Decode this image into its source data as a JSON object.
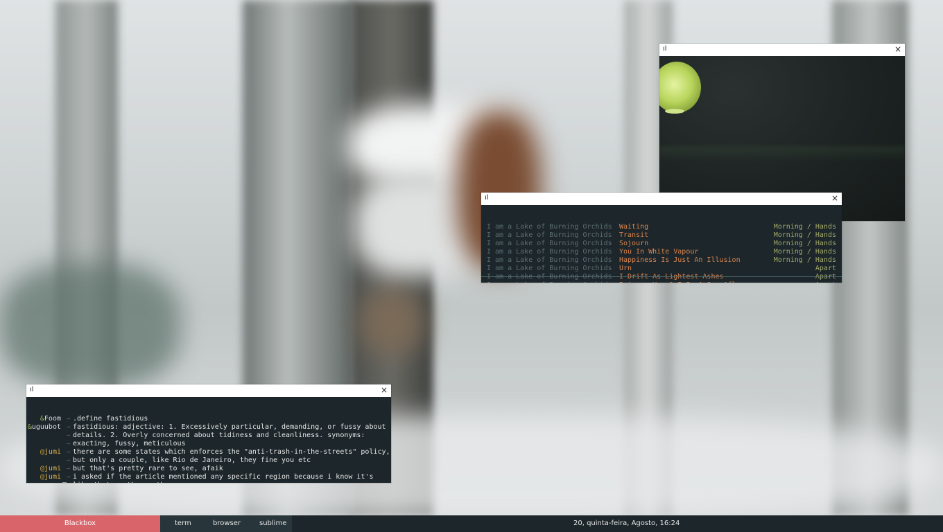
{
  "desktop": {
    "viewer_window": {
      "close_glyph": "×"
    },
    "music_window": {
      "close_glyph": "×",
      "tracks": [
        {
          "artist": "I am a Lake of Burning Orchids",
          "title": "Waiting",
          "album": "Morning / Hands"
        },
        {
          "artist": "I am a Lake of Burning Orchids",
          "title": "Transit",
          "album": "Morning / Hands"
        },
        {
          "artist": "I am a Lake of Burning Orchids",
          "title": "Sojourn",
          "album": "Morning / Hands"
        },
        {
          "artist": "I am a Lake of Burning Orchids",
          "title": "You In White Vapour",
          "album": "Morning / Hands"
        },
        {
          "artist": "I am a Lake of Burning Orchids",
          "title": "Happiness Is Just An Illusion",
          "album": "Morning / Hands"
        },
        {
          "artist": "I am a Lake of Burning Orchids",
          "title": "Urn",
          "album": "Apart"
        },
        {
          "artist": "I am a Lake of Burning Orchids",
          "title": "I Drift As Lightest Ashes",
          "album": "Apart"
        },
        {
          "artist": "I am a Lake of Burning Orchids",
          "title": "Between You & I Is A Sea Aflame",
          "album": "Apart"
        }
      ]
    },
    "irc_window": {
      "close_glyph": "×",
      "arrow": "→",
      "prompt": ">",
      "lines": [
        {
          "sig": "&",
          "nick": "Foom",
          "style": "normal",
          "msg": ".define fastidious"
        },
        {
          "sig": "&",
          "nick": "uguubot",
          "style": "normal",
          "msg": "fastidious: adjective: 1. Excessively particular, demanding, or fussy about"
        },
        {
          "sig": "",
          "nick": "",
          "style": "normal",
          "msg": "details. 2. Overly concerned about tidiness and cleanliness. synonyms:"
        },
        {
          "sig": "",
          "nick": "",
          "style": "normal",
          "msg": "exacting, fussy, meticulous"
        },
        {
          "sig": "@",
          "nick": "jumi",
          "style": "op",
          "msg": "there are some states which enforces the \"anti-trash-in-the-streets\" policy,"
        },
        {
          "sig": "",
          "nick": "",
          "style": "op",
          "msg": "but only a couple, like Rio de Janeiro, they fine you etc"
        },
        {
          "sig": "@",
          "nick": "jumi",
          "style": "op",
          "msg": "but that's pretty rare to see, afaik"
        },
        {
          "sig": "@",
          "nick": "jumi",
          "style": "op",
          "msg": "i asked if the article mentioned any specific region because i know it's"
        },
        {
          "sig": "",
          "nick": "",
          "style": "op",
          "msg": "like that on the south"
        }
      ]
    }
  },
  "taskbar": {
    "workspace": "Blackbox",
    "tasks": [
      "term",
      "browser",
      "sublime"
    ],
    "clock": "20, quinta-feira, Agosto, 16:24",
    "colors": {
      "accent": "#d9656b",
      "bar": "#1d262a"
    }
  }
}
